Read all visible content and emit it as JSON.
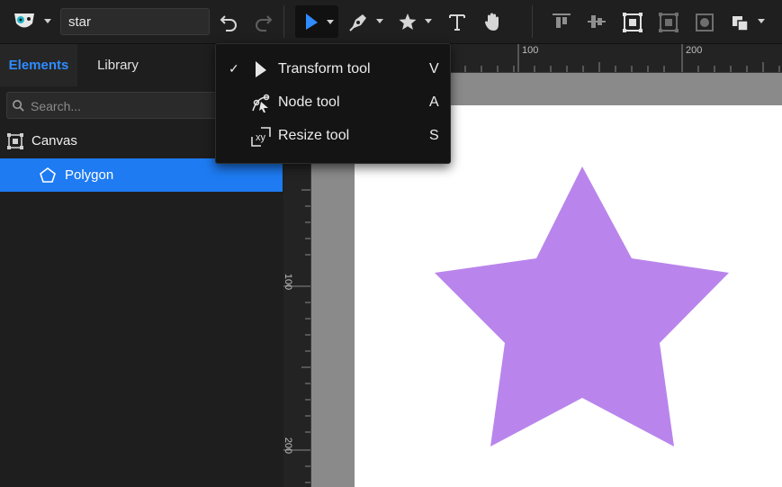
{
  "toolbar": {
    "file_name": "star",
    "icons": {
      "app_menu": "app-logo-icon",
      "undo": "undo-icon",
      "redo": "redo-icon",
      "transform": "pointer-arrow-icon",
      "pen": "pen-icon",
      "shape": "star-icon",
      "text": "text-icon",
      "pan": "hand-icon",
      "align_top": "align-top-icon",
      "align_middle": "align-middle-icon",
      "group": "group-icon",
      "ungroup": "ungroup-icon",
      "mask": "mask-icon",
      "arrange": "arrange-icon"
    }
  },
  "panel": {
    "tabs": [
      {
        "label": "Elements",
        "active": true
      },
      {
        "label": "Library",
        "active": false
      }
    ],
    "search_placeholder": "Search...",
    "tree": [
      {
        "label": "Canvas",
        "icon": "artboard-icon",
        "selected": false
      },
      {
        "label": "Polygon",
        "icon": "pentagon-icon",
        "selected": true
      }
    ]
  },
  "rulers": {
    "top": [
      "100",
      "200"
    ],
    "left": [
      "100",
      "200"
    ]
  },
  "tool_menu": {
    "items": [
      {
        "label": "Transform tool",
        "shortcut": "V",
        "checked": true,
        "icon": "pointer-arrow-icon"
      },
      {
        "label": "Node tool",
        "shortcut": "A",
        "checked": false,
        "icon": "node-tool-icon"
      },
      {
        "label": "Resize tool",
        "shortcut": "S",
        "checked": false,
        "icon": "resize-xy-icon"
      }
    ],
    "check_mark": "✓"
  },
  "canvas": {
    "shape": "star",
    "fill_color": "#b985ec",
    "artboard_color": "#ffffff",
    "workspace_color": "#8a8a8a"
  },
  "colors": {
    "accent": "#2f8cff",
    "selection": "#1e7bf2",
    "transform_tool_icon": "#2f8cff"
  }
}
